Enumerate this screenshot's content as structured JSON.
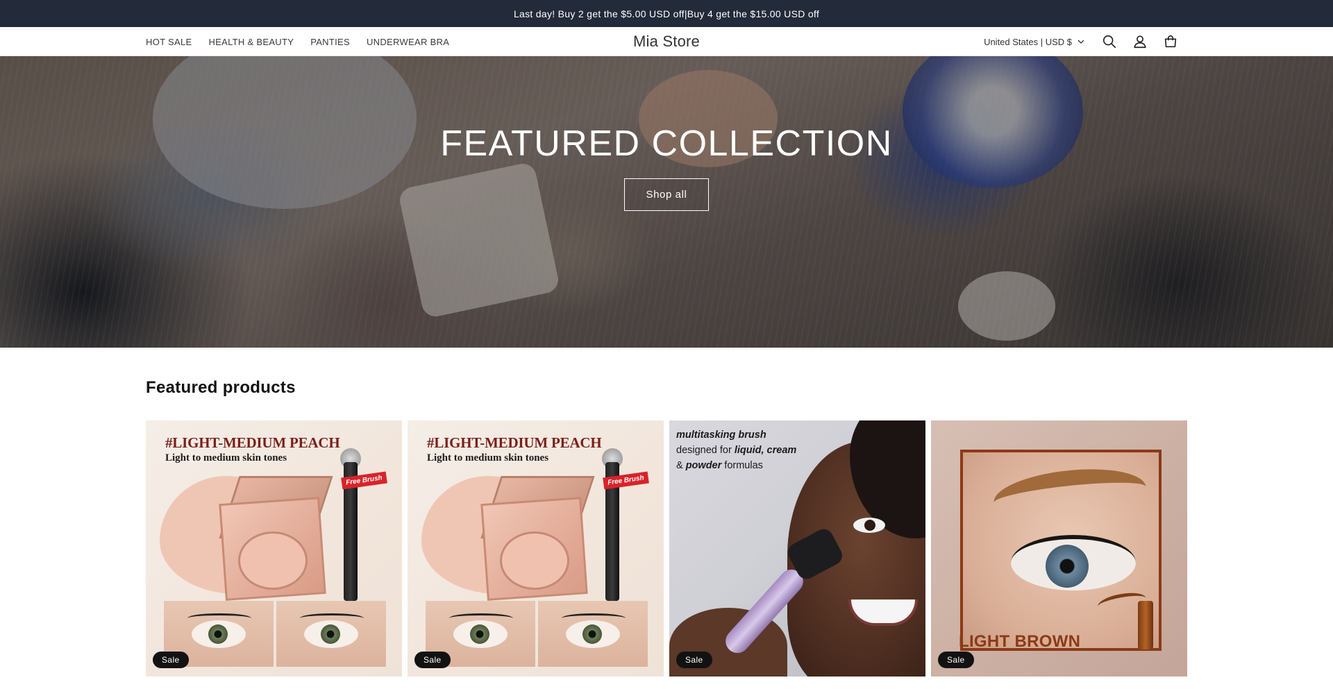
{
  "announcement": "Last day!   Buy 2 get the  $5.00 USD off|Buy 4 get the  $15.00 USD off",
  "header": {
    "nav": [
      "HOT SALE",
      "HEALTH & BEAUTY",
      "PANTIES",
      "UNDERWEAR BRA"
    ],
    "logo": "Mia Store",
    "country_selector": "United States | USD $",
    "icons": [
      "search-icon",
      "account-icon",
      "cart-icon"
    ]
  },
  "hero": {
    "title": "FEATURED COLLECTION",
    "button": "Shop all"
  },
  "featured": {
    "title": "Featured products",
    "products": [
      {
        "image_text_title": "#LIGHT-MEDIUM PEACH",
        "image_text_sub": "Light to medium skin tones",
        "image_tag": "Free Brush",
        "badge": "Sale"
      },
      {
        "image_text_title": "#LIGHT-MEDIUM PEACH",
        "image_text_sub": "Light to medium skin tones",
        "image_tag": "Free Brush",
        "badge": "Sale"
      },
      {
        "image_text_line1": "multitasking brush",
        "image_text_line2a": "designed for ",
        "image_text_line2b": "liquid, cream",
        "image_text_line3a": "& ",
        "image_text_line3b": "powder",
        "image_text_line3c": " formulas",
        "badge": "Sale"
      },
      {
        "image_text_title": "LIGHT BROWN",
        "badge": "Sale"
      }
    ]
  },
  "colors": {
    "announcement_bg": "#232a3a",
    "badge_bg": "#121212",
    "brand_text": "#121212"
  }
}
